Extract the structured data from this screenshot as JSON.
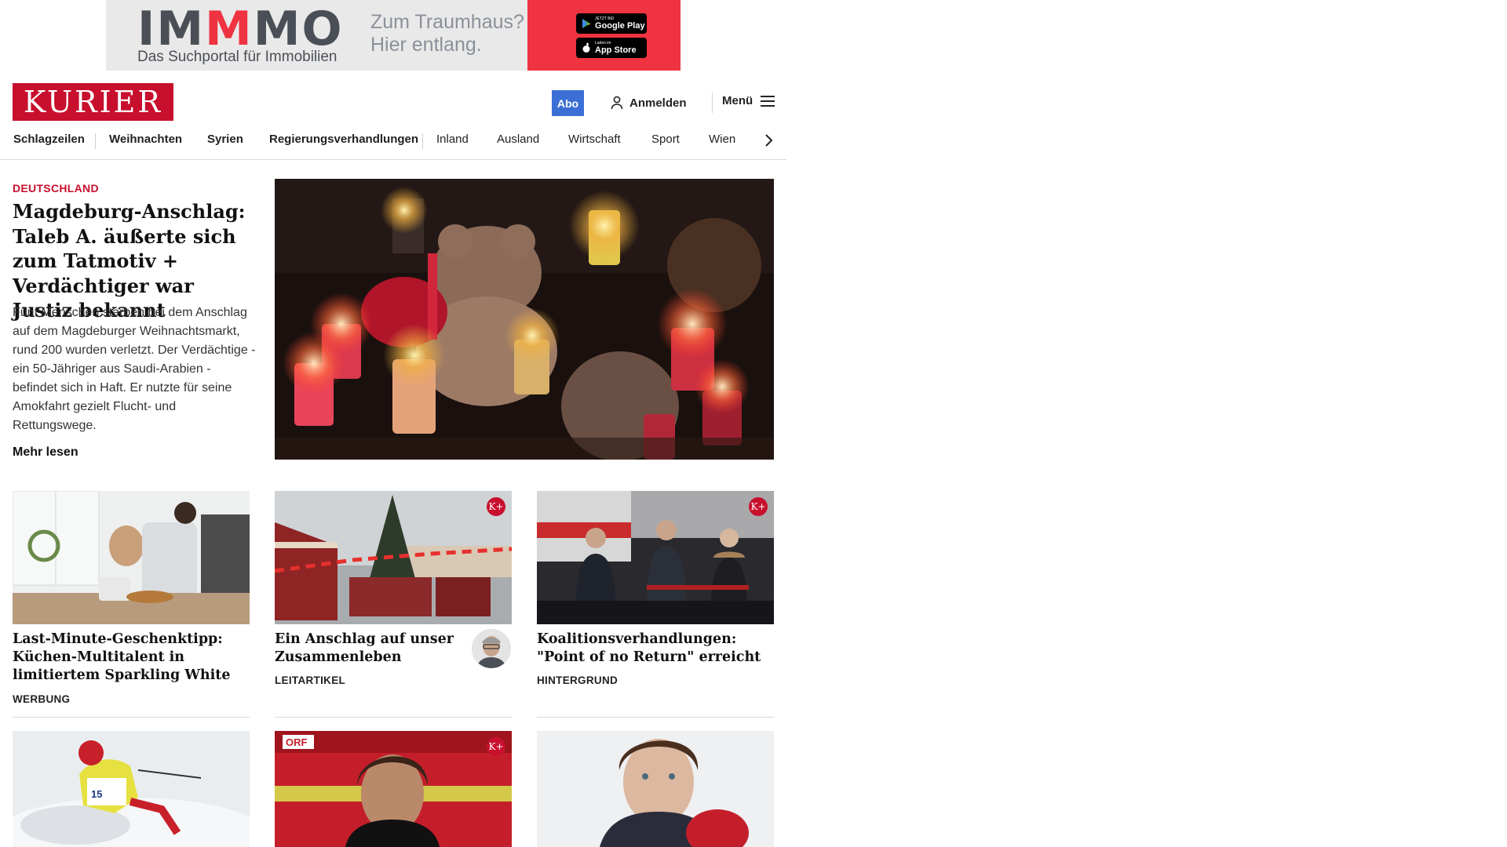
{
  "ad": {
    "logo_a": "IM",
    "logo_m": "M",
    "logo_b": "MO",
    "tagline": "Das Suchportal für Immobilien",
    "claim_line1": "Zum Traumhaus?",
    "claim_line2": "Hier entlang.",
    "google_small": "JETZT BEI",
    "google_big": "Google Play",
    "apple_small": "Laden im",
    "apple_big": "App Store"
  },
  "header": {
    "logo": "KURIER",
    "abo": "Abo",
    "login": "Anmelden",
    "menu": "Menü"
  },
  "nav": [
    "Schlagzeilen",
    "Weihnachten",
    "Syrien",
    "Regierungsverhandlungen",
    "Inland",
    "Ausland",
    "Wirtschaft",
    "Sport",
    "Wien"
  ],
  "lead": {
    "kicker": "DEUTSCHLAND",
    "headline": "Magdeburg-Anschlag: Taleb A. äußerte sich zum Tatmotiv + Verdächtiger war Justiz bekannt",
    "teaser": "Fünf Menschen starben bei dem Anschlag auf dem Magdeburger Weihnachtsmarkt, rund 200 wurden verletzt. Der Verdächtige - ein 50-Jähriger aus Saudi-Arabien - befindet sich in Haft. Er nutzte für seine Amokfahrt gezielt Flucht- und Rettungswege.",
    "more": "Mehr lesen"
  },
  "cards": [
    {
      "headline": "Last-Minute-Geschenktipp: Kü­chen-Multitalent in limitiertem Sparkling White",
      "tag": "WERBUNG"
    },
    {
      "headline": "Ein Anschlag auf unser Zusammenleben",
      "tag": "LEITARTIKEL",
      "badge": "K+"
    },
    {
      "headline": "Koalitionsverhandlungen: \"Point of no Return\" erreicht",
      "tag": "HINTERGRUND",
      "badge": "K+"
    }
  ],
  "cards_row2": [
    {
      "badge": ""
    },
    {
      "badge": "K+"
    },
    {
      "badge": ""
    }
  ]
}
